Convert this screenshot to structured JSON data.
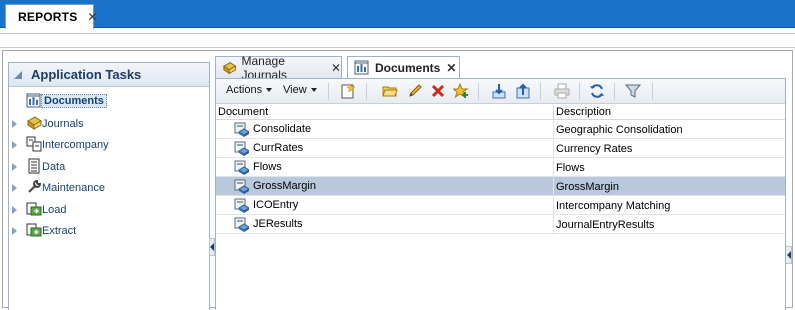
{
  "app_tab": {
    "label": "REPORTS",
    "close": "✕"
  },
  "left_panel": {
    "title": "Application Tasks",
    "items": [
      {
        "label": "Documents",
        "icon": "documents-icon",
        "selected": true
      },
      {
        "label": "Journals",
        "icon": "journals-icon"
      },
      {
        "label": "Intercompany",
        "icon": "intercompany-icon"
      },
      {
        "label": "Data",
        "icon": "data-icon"
      },
      {
        "label": "Maintenance",
        "icon": "maintenance-icon"
      },
      {
        "label": "Load",
        "icon": "load-icon"
      },
      {
        "label": "Extract",
        "icon": "extract-icon"
      }
    ]
  },
  "tabs": [
    {
      "label": "Manage Journals",
      "close": "✕"
    },
    {
      "label": "Documents",
      "close": "✕",
      "active": true
    }
  ],
  "toolbar": {
    "actions_label": "Actions",
    "view_label": "View"
  },
  "grid": {
    "columns": [
      "Document",
      "Description"
    ],
    "rows": [
      {
        "document": "Consolidate",
        "description": "Geographic Consolidation"
      },
      {
        "document": "CurrRates",
        "description": "Currency Rates"
      },
      {
        "document": "Flows",
        "description": "Flows"
      },
      {
        "document": "GrossMargin",
        "description": "GrossMargin",
        "selected": true
      },
      {
        "document": "ICOEntry",
        "description": "Intercompany Matching"
      },
      {
        "document": "JEResults",
        "description": "JournalEntryResults"
      }
    ]
  },
  "colors": {
    "header_blue": "#1a73c9",
    "selected_row": "#b9c8db",
    "link_text": "#15436f"
  }
}
